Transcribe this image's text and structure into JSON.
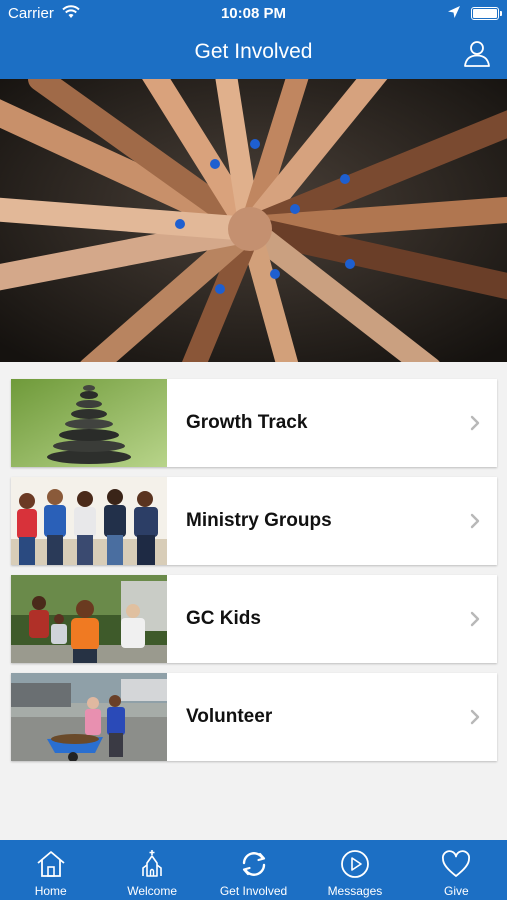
{
  "status_bar": {
    "carrier": "Carrier",
    "time": "10:08 PM"
  },
  "header": {
    "title": "Get Involved"
  },
  "hero": {
    "description_icon": "hands-together-photo"
  },
  "items": [
    {
      "label": "Growth Track",
      "thumb": "stacked-stones-photo"
    },
    {
      "label": "Ministry Groups",
      "thumb": "group-people-photo"
    },
    {
      "label": "GC Kids",
      "thumb": "kids-playing-photo"
    },
    {
      "label": "Volunteer",
      "thumb": "volunteers-wheelbarrow-photo"
    }
  ],
  "tabs": [
    {
      "label": "Home",
      "icon": "house-icon"
    },
    {
      "label": "Welcome",
      "icon": "church-icon"
    },
    {
      "label": "Get Involved",
      "icon": "refresh-arrows-icon"
    },
    {
      "label": "Messages",
      "icon": "play-circle-icon"
    },
    {
      "label": "Give",
      "icon": "heart-icon"
    }
  ],
  "colors": {
    "brand": "#1c6fc4",
    "background": "#f2f2f2",
    "card": "#ffffff"
  }
}
